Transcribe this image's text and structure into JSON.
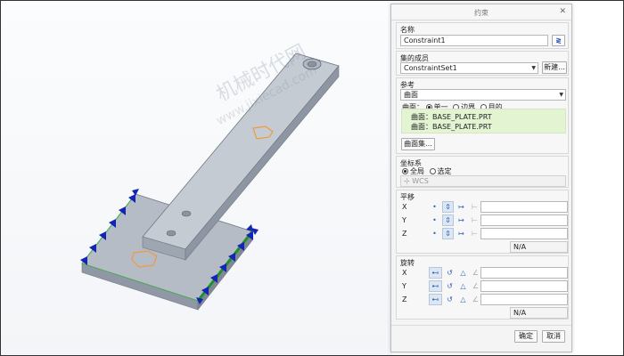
{
  "watermark": {
    "line1": "机械时代网",
    "line2": "www.jixiecad.com"
  },
  "dialog": {
    "title": "约束",
    "close_icon": "close-icon",
    "name": {
      "label": "名称",
      "value": "Constraint1"
    },
    "set": {
      "label": "集的成员",
      "value": "ConstraintSet1",
      "new_button": "新建..."
    },
    "reference": {
      "label": "参考",
      "type_value": "曲面",
      "mode_prefix": "曲面：",
      "modes": [
        "单一",
        "边界",
        "目的"
      ],
      "selected_mode": "单一",
      "items": [
        "曲面：BASE_PLATE.PRT",
        "曲面：BASE_PLATE.PRT"
      ],
      "collect_button": "曲面集..."
    },
    "coord": {
      "label": "坐标系",
      "options": [
        "全局",
        "选定"
      ],
      "selected": "全局",
      "wcs": "WCS"
    },
    "translation": {
      "label": "平移",
      "axes": [
        "X",
        "Y",
        "Z"
      ],
      "status": "N/A"
    },
    "rotation": {
      "label": "旋转",
      "axes": [
        "X",
        "Y",
        "Z"
      ],
      "status": "N/A"
    },
    "footer": {
      "ok": "确定",
      "cancel": "取消"
    }
  }
}
